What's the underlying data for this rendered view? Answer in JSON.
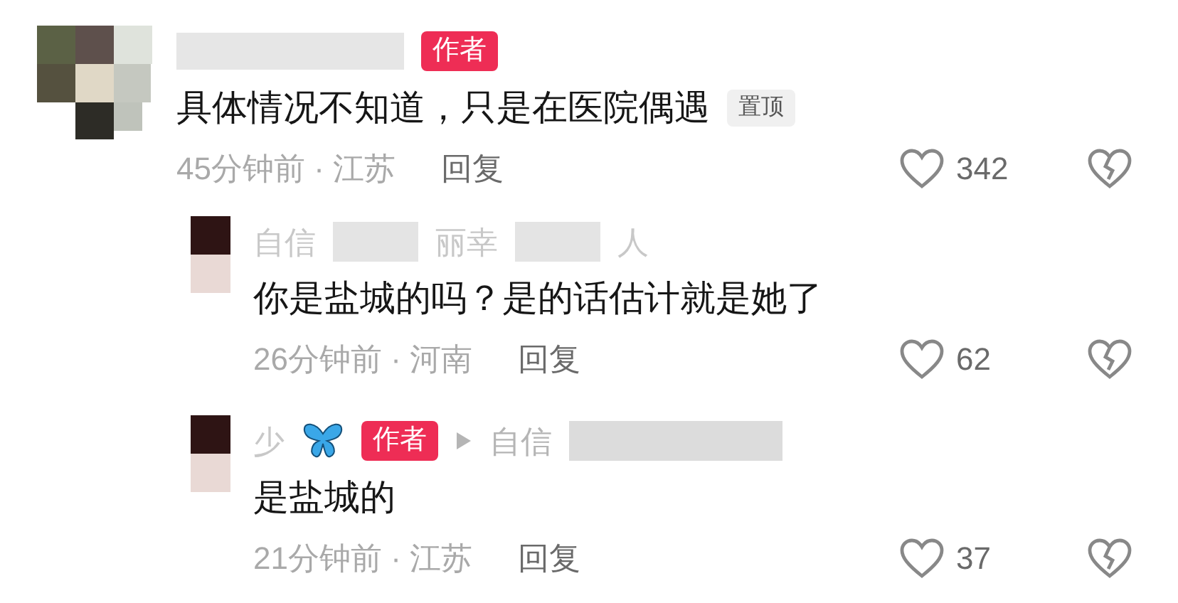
{
  "comments": [
    {
      "author_badge": "作者",
      "text": "具体情况不知道，只是在医院偶遇",
      "pinned_badge": "置顶",
      "meta": "45分钟前 · 江苏",
      "reply_label": "回复",
      "likes": "342",
      "kind": "top"
    },
    {
      "name_parts": [
        "自信",
        "丽幸",
        "人"
      ],
      "text": "你是盐城的吗？是的话估计就是她了",
      "meta": "26分钟前 · 河南",
      "reply_label": "回复",
      "likes": "62",
      "kind": "reply"
    },
    {
      "name_parts": [
        "少"
      ],
      "author_badge": "作者",
      "reply_to": "自信",
      "text": "是盐城的",
      "meta": "21分钟前 · 江苏",
      "reply_label": "回复",
      "likes": "37",
      "kind": "reply"
    }
  ]
}
